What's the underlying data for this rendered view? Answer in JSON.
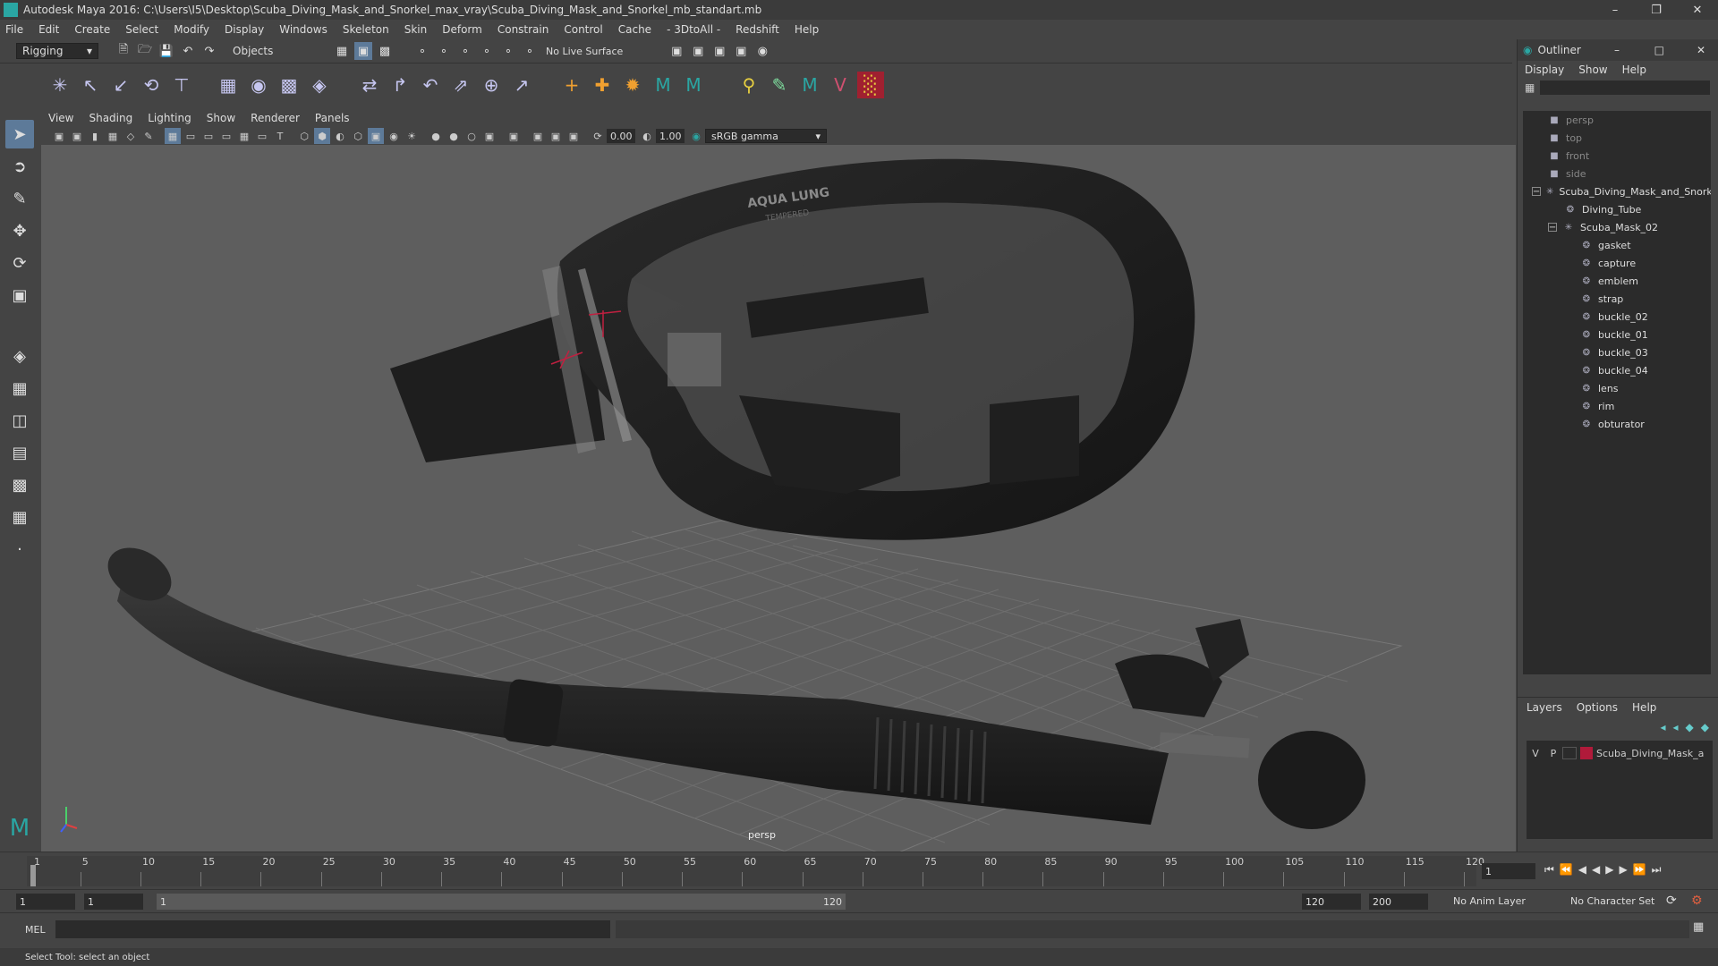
{
  "window": {
    "title": "Autodesk Maya 2016: C:\\Users\\I5\\Desktop\\Scuba_Diving_Mask_and_Snorkel_max_vray\\Scuba_Diving_Mask_and_Snorkel_mb_standart.mb"
  },
  "menubar": [
    "File",
    "Edit",
    "Create",
    "Select",
    "Modify",
    "Display",
    "Windows",
    "Skeleton",
    "Skin",
    "Deform",
    "Constrain",
    "Control",
    "Cache",
    "- 3DtoAll -",
    "Redshift",
    "Help"
  ],
  "statusline": {
    "mode": "Rigging",
    "selection_mode": "Objects",
    "live_surface": "No Live Surface"
  },
  "panel": {
    "menus": [
      "View",
      "Shading",
      "Lighting",
      "Show",
      "Renderer",
      "Panels"
    ],
    "exposure": "0.00",
    "gamma": "1.00",
    "colorspace": "sRGB gamma",
    "camera_label": "persp"
  },
  "outliner": {
    "title": "Outliner",
    "menus": [
      "Display",
      "Show",
      "Help"
    ],
    "items": [
      {
        "label": "persp",
        "depth": 0,
        "dim": true,
        "icon": "camera-icon"
      },
      {
        "label": "top",
        "depth": 0,
        "dim": true,
        "icon": "camera-icon"
      },
      {
        "label": "front",
        "depth": 0,
        "dim": true,
        "icon": "camera-icon"
      },
      {
        "label": "side",
        "depth": 0,
        "dim": true,
        "icon": "camera-icon"
      },
      {
        "label": "Scuba_Diving_Mask_and_Snorkel",
        "depth": 0,
        "dim": false,
        "icon": "group-icon",
        "expand": "−"
      },
      {
        "label": "Diving_Tube",
        "depth": 1,
        "dim": false,
        "icon": "mesh-icon"
      },
      {
        "label": "Scuba_Mask_02",
        "depth": 1,
        "dim": false,
        "icon": "group-icon",
        "expand": "−"
      },
      {
        "label": "gasket",
        "depth": 2,
        "dim": false,
        "icon": "mesh-icon"
      },
      {
        "label": "capture",
        "depth": 2,
        "dim": false,
        "icon": "mesh-icon"
      },
      {
        "label": "emblem",
        "depth": 2,
        "dim": false,
        "icon": "mesh-icon"
      },
      {
        "label": "strap",
        "depth": 2,
        "dim": false,
        "icon": "mesh-icon"
      },
      {
        "label": "buckle_02",
        "depth": 2,
        "dim": false,
        "icon": "mesh-icon"
      },
      {
        "label": "buckle_01",
        "depth": 2,
        "dim": false,
        "icon": "mesh-icon"
      },
      {
        "label": "buckle_03",
        "depth": 2,
        "dim": false,
        "icon": "mesh-icon"
      },
      {
        "label": "buckle_04",
        "depth": 2,
        "dim": false,
        "icon": "mesh-icon"
      },
      {
        "label": "lens",
        "depth": 2,
        "dim": false,
        "icon": "mesh-icon"
      },
      {
        "label": "rim",
        "depth": 2,
        "dim": false,
        "icon": "mesh-icon"
      },
      {
        "label": "obturator",
        "depth": 2,
        "dim": false,
        "icon": "mesh-icon"
      }
    ]
  },
  "layers": {
    "menus": [
      "Layers",
      "Options",
      "Help"
    ],
    "layer": {
      "v": "V",
      "p": "P",
      "name": "Scuba_Diving_Mask_and_Snorkel",
      "color": "#b01a3a"
    }
  },
  "timeline": {
    "ticks": [
      "1",
      "5",
      "10",
      "15",
      "20",
      "25",
      "30",
      "35",
      "40",
      "45",
      "50",
      "55",
      "60",
      "65",
      "70",
      "75",
      "80",
      "85",
      "90",
      "95",
      "100",
      "105",
      "110",
      "115",
      "120"
    ],
    "current_frame": "1"
  },
  "range": {
    "start": "1",
    "anim_start": "1",
    "range_start_label": "1",
    "range_end_label": "120",
    "end": "120",
    "anim_end": "200",
    "anim_layer": "No Anim Layer",
    "character_set": "No Character Set"
  },
  "cmdline": {
    "label": "MEL"
  },
  "helpline": {
    "text": "Select Tool: select an object"
  },
  "emblem_text": {
    "line1": "AQUA LUNG",
    "line2": "TEMPERED"
  }
}
